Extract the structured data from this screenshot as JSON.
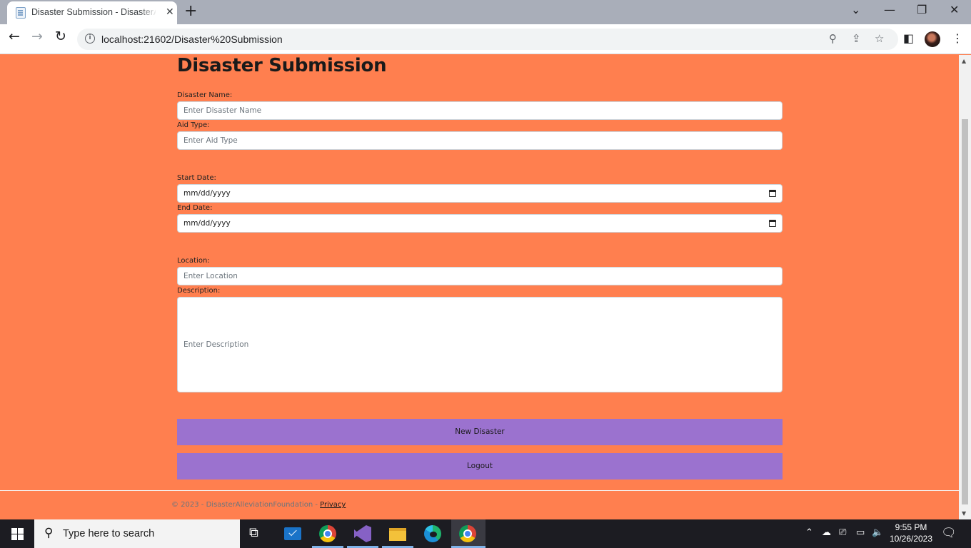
{
  "browser": {
    "tab_title": "Disaster Submission - DisasterAl",
    "tab_close": "✕",
    "new_tab": "+",
    "url": "localhost:21602/Disaster%20Submission",
    "window_controls": {
      "dropdown": "⌄",
      "minimize": "—",
      "restore": "❐",
      "close": "✕"
    }
  },
  "page": {
    "title": "Disaster Submission",
    "form": {
      "disaster_name_label": "Disaster Name:",
      "disaster_name_placeholder": "Enter Disaster Name",
      "aid_type_label": "Aid Type:",
      "aid_type_placeholder": "Enter Aid Type",
      "start_date_label": "Start Date:",
      "start_date_value": "mm/dd/yyyy",
      "end_date_label": "End Date:",
      "end_date_value": "mm/dd/yyyy",
      "location_label": "Location:",
      "location_placeholder": "Enter Location",
      "description_label": "Description:",
      "description_placeholder": "Enter Description"
    },
    "buttons": {
      "new_disaster": "New Disaster",
      "logout": "Logout"
    },
    "footer": {
      "copyright": "© 2023 - DisasterAlleviationFoundation -",
      "privacy_link": "Privacy"
    }
  },
  "taskbar": {
    "search_placeholder": "Type here to search",
    "time": "9:55 PM",
    "date": "10/26/2023"
  },
  "colors": {
    "page_bg": "#ff7f4f",
    "button_bg": "#9b72cf"
  }
}
